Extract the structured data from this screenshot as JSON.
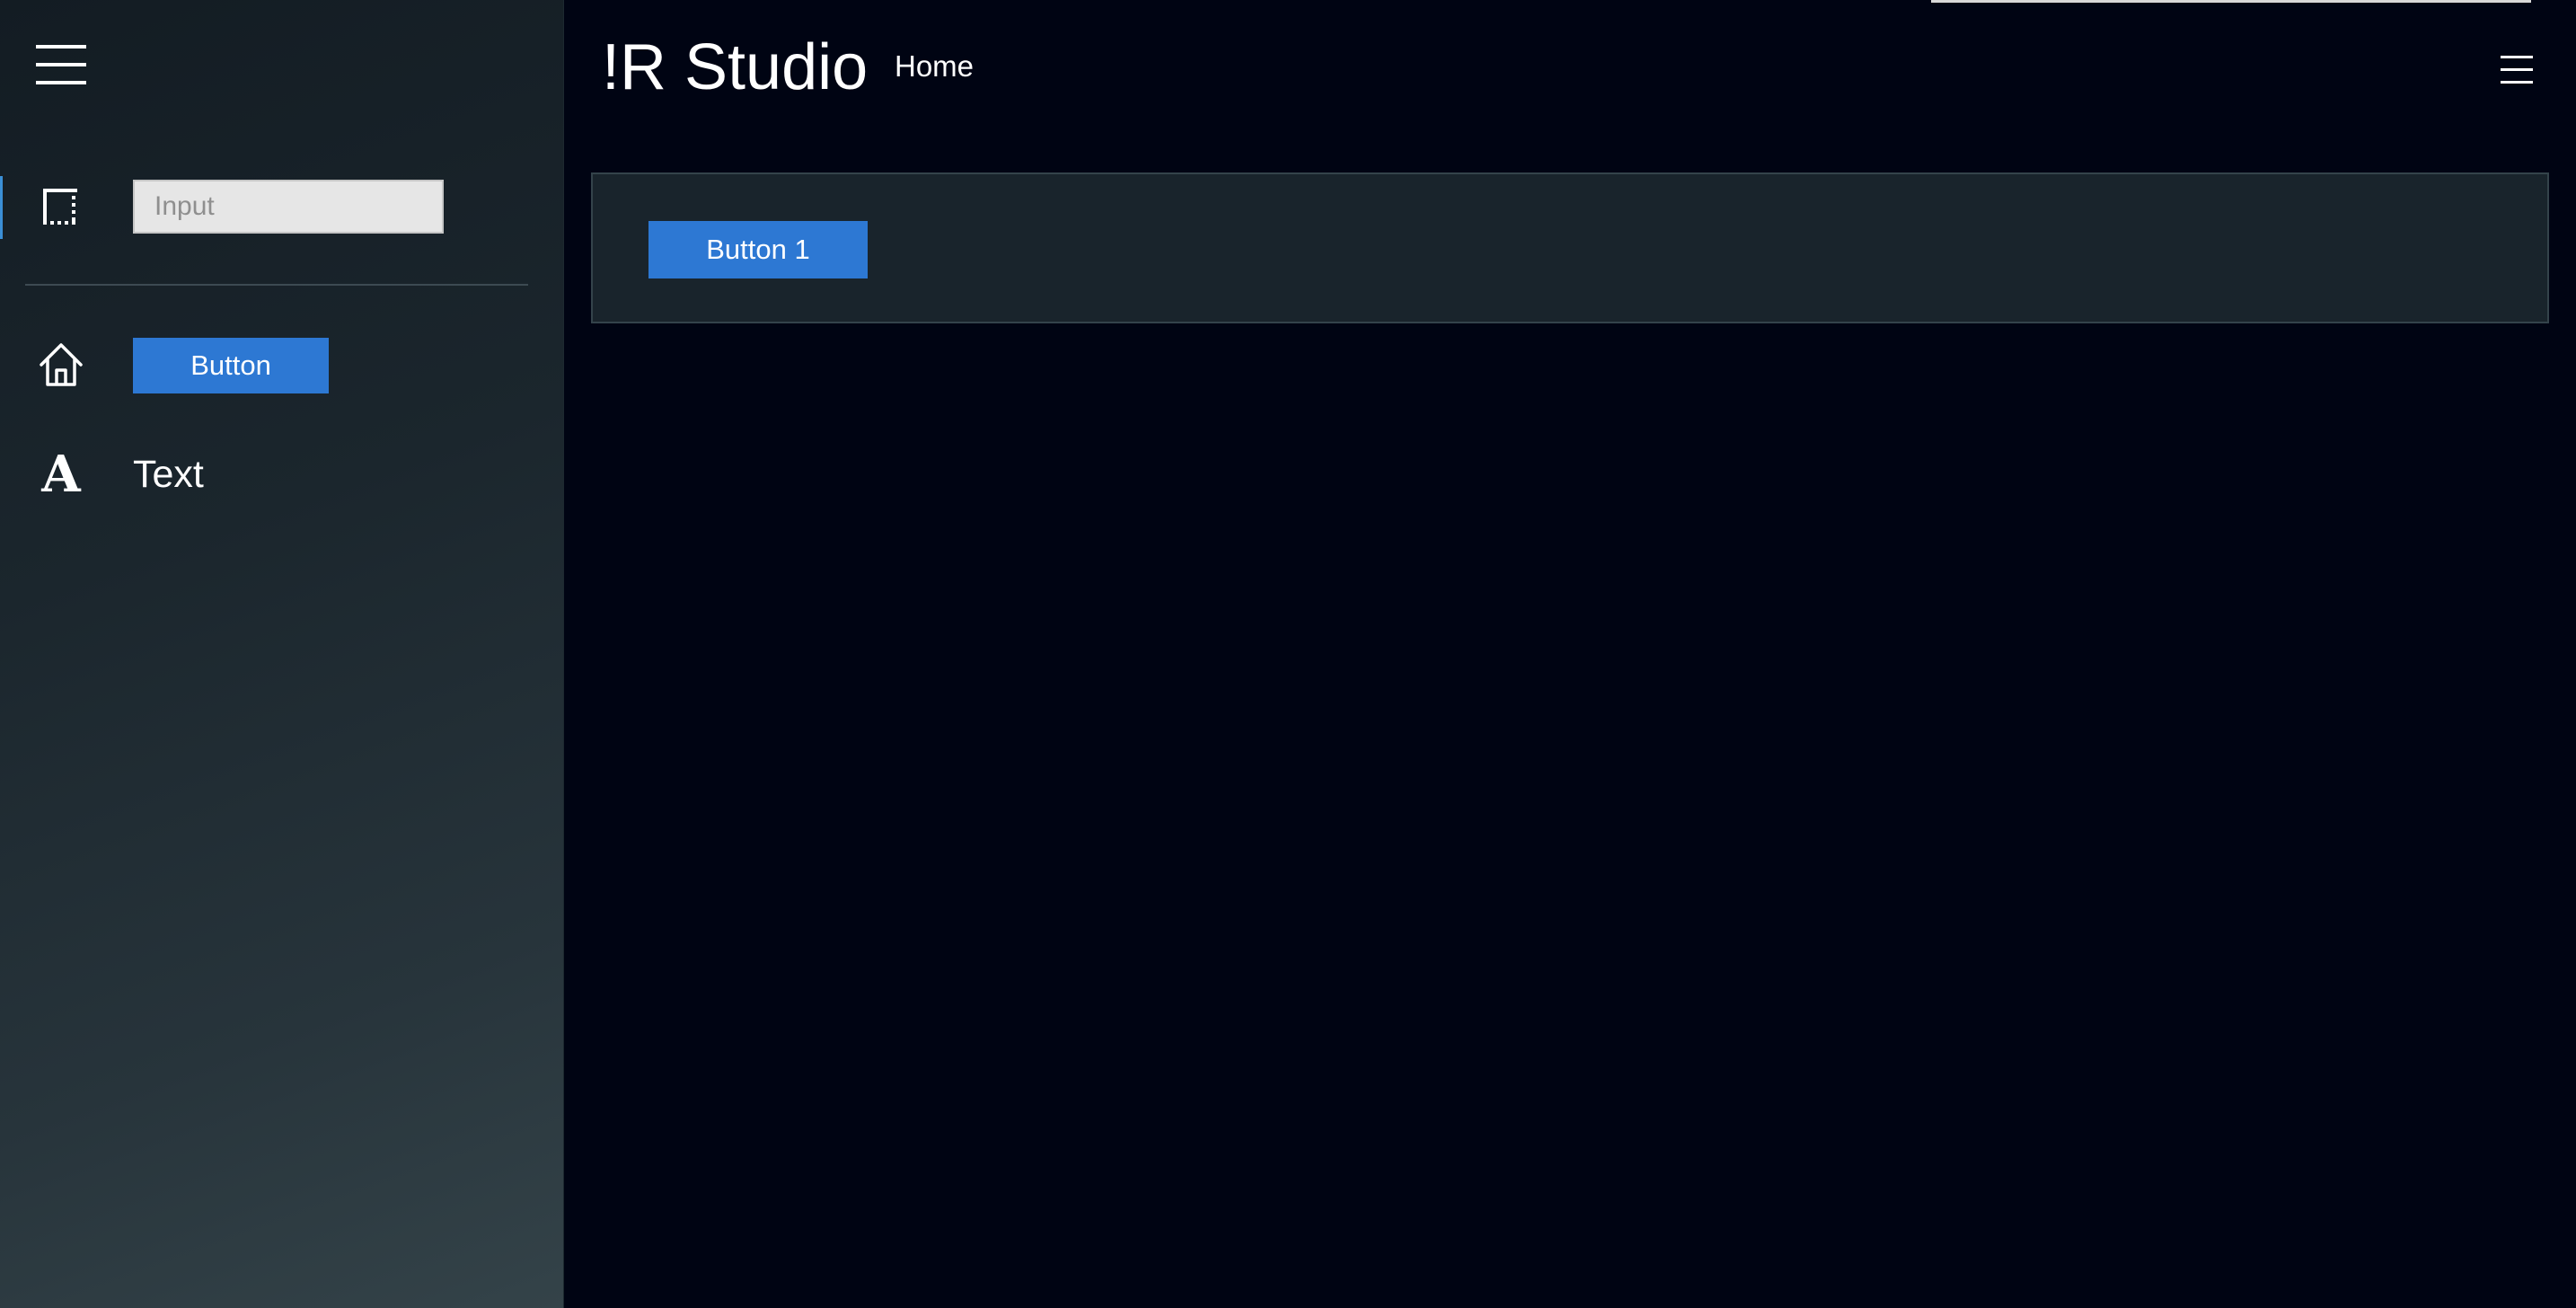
{
  "app": {
    "title": "!R Studio"
  },
  "header": {
    "nav_home": "Home",
    "menu_icon": "hamburger-icon"
  },
  "sidebar": {
    "menu_icon": "hamburger-icon",
    "items": [
      {
        "icon": "input-field-icon",
        "type": "input",
        "placeholder": "Input",
        "value": ""
      },
      {
        "icon": "home-icon",
        "type": "button",
        "label": "Button"
      },
      {
        "icon": "text-icon",
        "type": "text",
        "label": "Text",
        "icon_glyph": "A"
      }
    ]
  },
  "main": {
    "panel": {
      "button_label": "Button 1"
    }
  },
  "colors": {
    "background": "#000413",
    "sidebar_top": "#131c23",
    "sidebar_bottom": "#344349",
    "accent": "#2d78d3",
    "active_indicator": "#3b8fd6",
    "panel_bg": "#19242c",
    "panel_border": "#34434b",
    "input_bg": "#e6e6e6"
  }
}
